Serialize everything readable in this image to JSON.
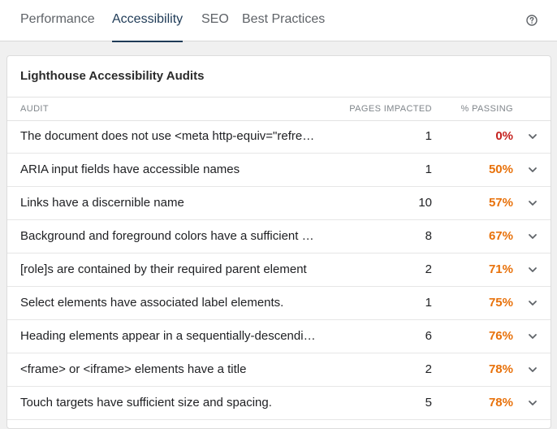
{
  "tabs": [
    {
      "label": "Performance",
      "active": false
    },
    {
      "label": "Accessibility",
      "active": true
    },
    {
      "label": "SEO",
      "active": false
    },
    {
      "label": "Best Practices",
      "active": false
    }
  ],
  "help_icon": "help-circle-icon",
  "card": {
    "title": "Lighthouse Accessibility Audits",
    "columns": {
      "audit": "AUDIT",
      "pages": "PAGES IMPACTED",
      "passing": "% PASSING"
    },
    "rows": [
      {
        "audit": "The document does not use <meta http-equiv=\"refresh\">",
        "pages": "1",
        "passing": "0%",
        "color": "#c5221f"
      },
      {
        "audit": "ARIA input fields have accessible names",
        "pages": "1",
        "passing": "50%",
        "color": "#e8710a"
      },
      {
        "audit": "Links have a discernible name",
        "pages": "10",
        "passing": "57%",
        "color": "#e8710a"
      },
      {
        "audit": "Background and foreground colors have a sufficient contrast ratio",
        "pages": "8",
        "passing": "67%",
        "color": "#e8710a"
      },
      {
        "audit": "[role]s are contained by their required parent element",
        "pages": "2",
        "passing": "71%",
        "color": "#e8710a"
      },
      {
        "audit": "Select elements have associated label elements.",
        "pages": "1",
        "passing": "75%",
        "color": "#e8710a"
      },
      {
        "audit": "Heading elements appear in a sequentially-descending order",
        "pages": "6",
        "passing": "76%",
        "color": "#e8710a"
      },
      {
        "audit": "<frame> or <iframe> elements have a title",
        "pages": "2",
        "passing": "78%",
        "color": "#e8710a"
      },
      {
        "audit": "Touch targets have sufficient size and spacing.",
        "pages": "5",
        "passing": "78%",
        "color": "#e8710a"
      }
    ],
    "row_icon": "chevron-down-icon"
  }
}
